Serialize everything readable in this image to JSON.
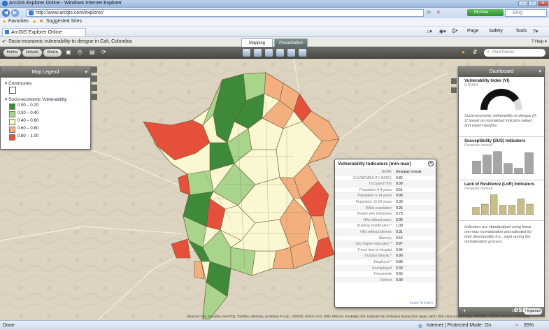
{
  "window": {
    "title": "ArcGIS Explorer Online - Windows Internet Explorer"
  },
  "browser": {
    "url": "http://www.arcgis.com/explorer/",
    "search_placeholder": "Bing",
    "mcafee": "McAfee"
  },
  "favorites": {
    "label": "Favorites",
    "suggested": "Suggested Sites"
  },
  "tab": {
    "label": "ArcGIS Explorer Online"
  },
  "commands": {
    "page": "Page",
    "safety": "Safety",
    "tools": "Tools"
  },
  "app": {
    "title": "Socio-economic vulnerability to dengue in Cali, Colombia",
    "tab_mapping": "Mapping",
    "tab_presentation": "Presentation",
    "help": "Help"
  },
  "toolbar": {
    "home": "Home",
    "details": "Details",
    "share": "Share",
    "find_placeholder": "Find Places"
  },
  "legend": {
    "title": "Map Legend",
    "communes_label": "Communes",
    "vulnerability_label": "Socio-economic Vulnerability",
    "classes": [
      {
        "label": "0.00 – 0.20",
        "color": "#3c8a3a"
      },
      {
        "label": "0.20 – 0.40",
        "color": "#a8d48c"
      },
      {
        "label": "0.40 – 0.60",
        "color": "#fbf7d0"
      },
      {
        "label": "0.60 – 0.80",
        "color": "#f3b07e"
      },
      {
        "label": "0.80 – 1.00",
        "color": "#e4503a"
      }
    ]
  },
  "dashboard": {
    "title": "Dashboard",
    "vi": {
      "title": "Vulnerability Index (VI)",
      "value": "0.81563",
      "value_fraction": 0.8156,
      "desc": "Socio-economic vulnerability to dengue [0-1] based on normalized indicator values and expert weights."
    },
    "sus": {
      "title": "Susceptibility (SUS) Indicators",
      "sub": "Desepaz Invicali",
      "bars": [
        0.55,
        0.8,
        0.95,
        0.45,
        0.25,
        0.9
      ]
    },
    "lor": {
      "title": "Lack of Resilience (LoR) Indicators",
      "sub": "Desepaz Invicali",
      "bars": [
        0.35,
        0.5,
        0.95,
        0.45,
        0.45,
        0.75,
        0.5
      ]
    },
    "note": "Indicators are standardized using linear min-max normalization and adjusted for their directionality (i.e., sign) during the normalization process.",
    "organize": "Organize"
  },
  "popup": {
    "title": "Vulnerability Indicators (min-max)",
    "rows": [
      {
        "k": "NAME",
        "v": "Desepaz Invicali"
      },
      {
        "k": "VULNERABILITY INDEX",
        "v": "0.82"
      },
      {
        "k": "Occupied HHs",
        "v": "0.00"
      },
      {
        "k": "Population 0-4 years",
        "v": "0.51"
      },
      {
        "k": "Population 5-14 years",
        "v": "0.96"
      },
      {
        "k": "Population 15-29 years",
        "v": "0.33"
      },
      {
        "k": "White population",
        "v": "0.26"
      },
      {
        "k": "People with limitations",
        "v": "0.73"
      },
      {
        "k": "HHs without water",
        "v": "0.05"
      },
      {
        "k": "Building stratification *",
        "v": "1.00"
      },
      {
        "k": "HHs without phones",
        "v": "0.31"
      },
      {
        "k": "Illiteracy",
        "v": "0.52"
      },
      {
        "k": "Sec./higher education *",
        "v": "0.97"
      },
      {
        "k": "Travel time to hospital",
        "v": "0.04"
      },
      {
        "k": "Hospital density *",
        "v": "0.90"
      },
      {
        "k": "Employed *",
        "v": "0.86"
      },
      {
        "k": "Unemployed",
        "v": "0.33"
      },
      {
        "k": "Housework",
        "v": "0.65"
      },
      {
        "k": "Retired",
        "v": "0.00"
      }
    ],
    "footer": "Zoom To   Edit ▾"
  },
  "attribution": "Sources: Esri, DeLorme, NAVTEQ, TomTom, Intermap, increment P Corp., GEBCO, USGS, FAO, NPS, NRCAN, GeoBase, IGN, Kadaster NL, Ordnance Survey, Esri Japan, METI, Esri China (Hong Kong), swisstopo, and the GIS User Community",
  "status": {
    "done": "Done",
    "zone": "Internet | Protected Mode: On",
    "zoom": "95%"
  }
}
